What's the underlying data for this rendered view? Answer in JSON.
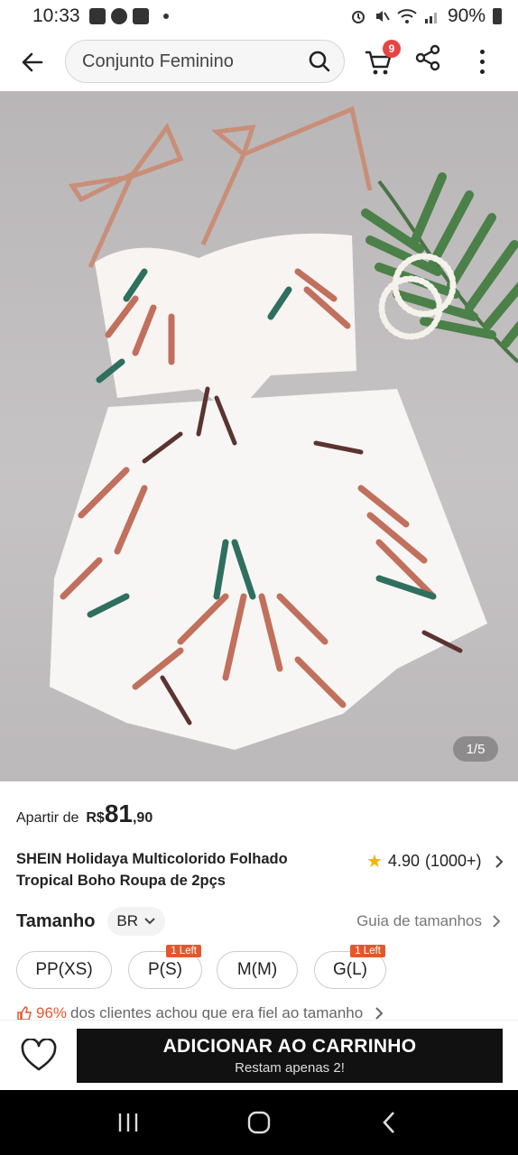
{
  "status_bar": {
    "time": "10:33",
    "battery": "90%"
  },
  "header": {
    "search_text": "Conjunto Feminino",
    "cart_badge": "9"
  },
  "image": {
    "page_indicator": "1/5"
  },
  "product": {
    "price_prefix": "Apartir de",
    "price_currency": "R$",
    "price_int": "81",
    "price_dec": ",90",
    "title": "SHEIN Holidaya Multicolorido Folhado Tropical Boho Roupa de 2pçs",
    "rating": "4.90",
    "rating_count": "(1000+)"
  },
  "size": {
    "label": "Tamanho",
    "system": "BR",
    "guide": "Guia de tamanhos",
    "options": [
      {
        "label": "PP(XS)",
        "tag": ""
      },
      {
        "label": "P(S)",
        "tag": "1 Left"
      },
      {
        "label": "M(M)",
        "tag": ""
      },
      {
        "label": "G(L)",
        "tag": "1 Left"
      }
    ],
    "fit_percent": "96%",
    "fit_text": "dos clientes achou que era fiel ao tamanho"
  },
  "action": {
    "add_to_cart": "ADICIONAR AO CARRINHO",
    "stock_note": "Restam apenas 2!"
  },
  "colors": {
    "accent": "#e4572e",
    "badge": "#e64545",
    "star": "#f5b400"
  }
}
